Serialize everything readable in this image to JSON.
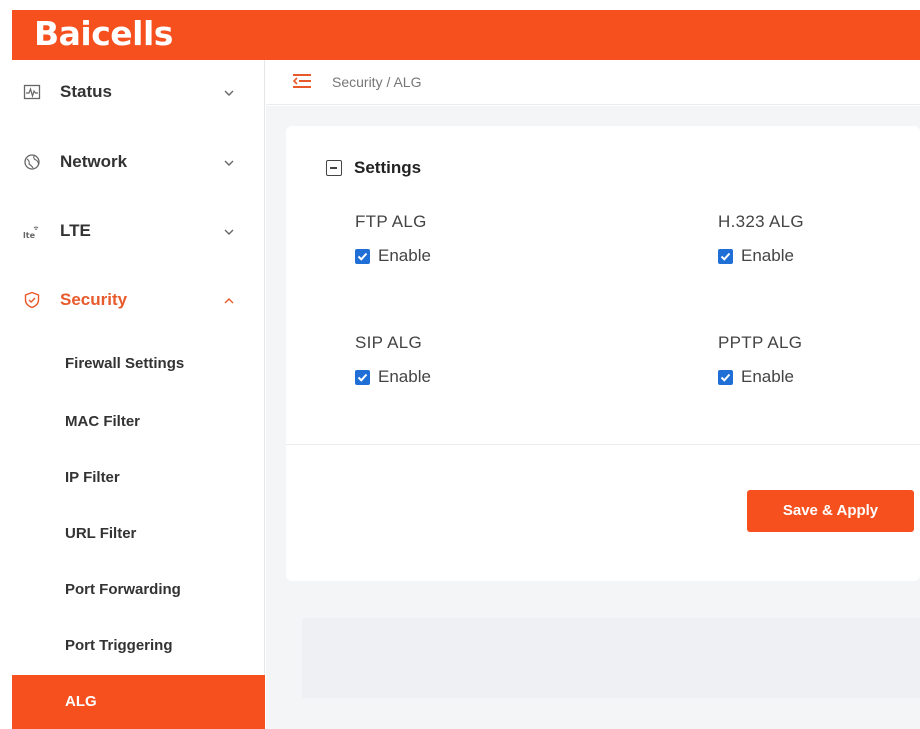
{
  "app": {
    "logo": "Baicells",
    "brand_color": "#f5501e"
  },
  "sidebar": {
    "menu": [
      {
        "label": "Status",
        "icon": "status-icon",
        "expanded": false
      },
      {
        "label": "Network",
        "icon": "globe-icon",
        "expanded": false
      },
      {
        "label": "LTE",
        "icon": "lte-icon",
        "expanded": false
      },
      {
        "label": "Security",
        "icon": "shield-icon",
        "expanded": true,
        "active": true
      }
    ],
    "security_items": [
      {
        "label": "Firewall Settings"
      },
      {
        "label": "MAC Filter"
      },
      {
        "label": "IP Filter"
      },
      {
        "label": "URL Filter"
      },
      {
        "label": "Port Forwarding"
      },
      {
        "label": "Port Triggering"
      },
      {
        "label": "ALG",
        "selected": true
      }
    ]
  },
  "breadcrumb": "Security / ALG",
  "settings": {
    "title": "Settings",
    "algs": [
      {
        "label": "FTP ALG",
        "checkbox_label": "Enable",
        "checked": true
      },
      {
        "label": "H.323 ALG",
        "checkbox_label": "Enable",
        "checked": true
      },
      {
        "label": "SIP ALG",
        "checkbox_label": "Enable",
        "checked": true
      },
      {
        "label": "PPTP ALG",
        "checkbox_label": "Enable",
        "checked": true
      }
    ],
    "save_label": "Save & Apply"
  }
}
